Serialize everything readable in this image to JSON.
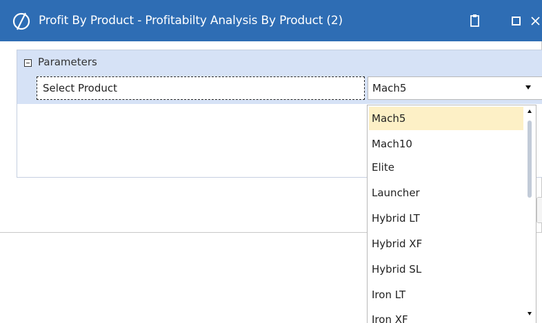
{
  "window": {
    "title": "Profit By Product - Profitabilty Analysis By Product (2)",
    "icons": {
      "logo": "app-logo-icon",
      "clipboard": "clipboard-icon",
      "maximize": "maximize-icon",
      "close": "close-icon"
    },
    "titlebar_color": "#2e6db4"
  },
  "parameters": {
    "header": "Parameters",
    "collapse_icon": "collapse-minus-icon",
    "fields": [
      {
        "label": "Select Product",
        "value": "Mach5"
      }
    ]
  },
  "dropdown": {
    "options": [
      "Mach5",
      "Mach10",
      "Elite",
      "Launcher",
      "Hybrid LT",
      "Hybrid XF",
      "Hybrid SL",
      "Iron LT",
      "Iron XF"
    ],
    "selected": "Mach5",
    "highlight_color": "#fdf0c6"
  }
}
